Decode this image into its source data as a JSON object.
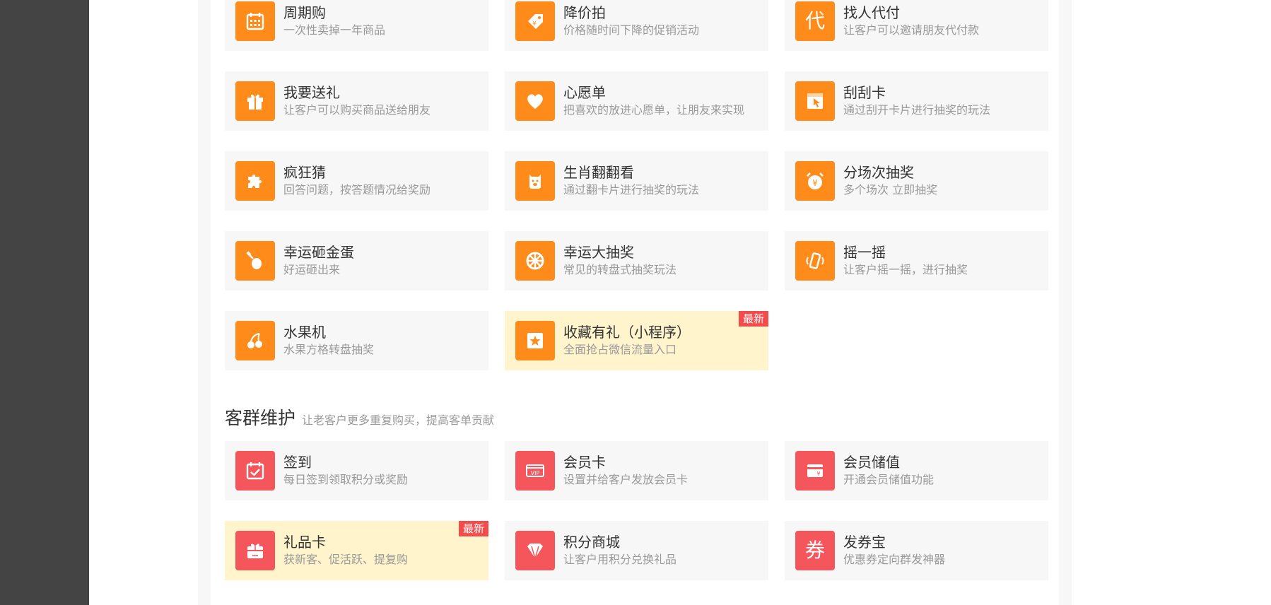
{
  "colors": {
    "orange": "#ff8c1a",
    "red": "#f5565c",
    "badge": "#f44b4b",
    "highlight": "#fff4cc",
    "card_bg": "#f7f7f7"
  },
  "section1": {
    "items": [
      {
        "title": "周期购",
        "desc": "一次性卖掉一年商品",
        "icon": "calendar-icon"
      },
      {
        "title": "降价拍",
        "desc": "价格随时间下降的促销活动",
        "icon": "price-tag-icon"
      },
      {
        "title": "找人代付",
        "desc": "让客户可以邀请朋友代付款",
        "icon": "proxy-pay-icon",
        "glyph": "代"
      },
      {
        "title": "我要送礼",
        "desc": "让客户可以购买商品送给朋友",
        "icon": "gift-icon"
      },
      {
        "title": "心愿单",
        "desc": "把喜欢的放进心愿单，让朋友来实现",
        "icon": "heart-icon"
      },
      {
        "title": "刮刮卡",
        "desc": "通过刮开卡片进行抽奖的玩法",
        "icon": "scratch-card-icon"
      },
      {
        "title": "疯狂猜",
        "desc": "回答问题，按答题情况给奖励",
        "icon": "puzzle-icon"
      },
      {
        "title": "生肖翻翻看",
        "desc": "通过翻卡片进行抽奖的玩法",
        "icon": "zodiac-icon"
      },
      {
        "title": "分场次抽奖",
        "desc": "多个场次 立即抽奖",
        "icon": "alarm-clock-icon"
      },
      {
        "title": "幸运砸金蛋",
        "desc": "好运砸出来",
        "icon": "golden-egg-icon"
      },
      {
        "title": "幸运大抽奖",
        "desc": "常见的转盘式抽奖玩法",
        "icon": "wheel-icon"
      },
      {
        "title": "摇一摇",
        "desc": "让客户摇一摇，进行抽奖",
        "icon": "shake-phone-icon"
      },
      {
        "title": "水果机",
        "desc": "水果方格转盘抽奖",
        "icon": "cherry-icon"
      },
      {
        "title": "收藏有礼（小程序）",
        "desc": "全面抢占微信流量入口",
        "icon": "star-icon",
        "badge": "最新"
      }
    ]
  },
  "section2": {
    "title": "客群维护",
    "subtitle": "让老客户更多重复购买，提高客单贡献",
    "items": [
      {
        "title": "签到",
        "desc": "每日签到领取积分或奖励",
        "icon": "checkin-calendar-icon"
      },
      {
        "title": "会员卡",
        "desc": "设置并给客户发放会员卡",
        "icon": "vip-card-icon",
        "glyph": "VIP"
      },
      {
        "title": "会员储值",
        "desc": "开通会员储值功能",
        "icon": "wallet-icon"
      },
      {
        "title": "礼品卡",
        "desc": "获新客、促活跃、提复购",
        "icon": "gift-card-icon",
        "badge": "最新"
      },
      {
        "title": "积分商城",
        "desc": "让客户用积分兑换礼品",
        "icon": "diamond-icon"
      },
      {
        "title": "发券宝",
        "desc": "优惠券定向群发神器",
        "icon": "coupon-icon",
        "glyph": "券"
      }
    ]
  }
}
